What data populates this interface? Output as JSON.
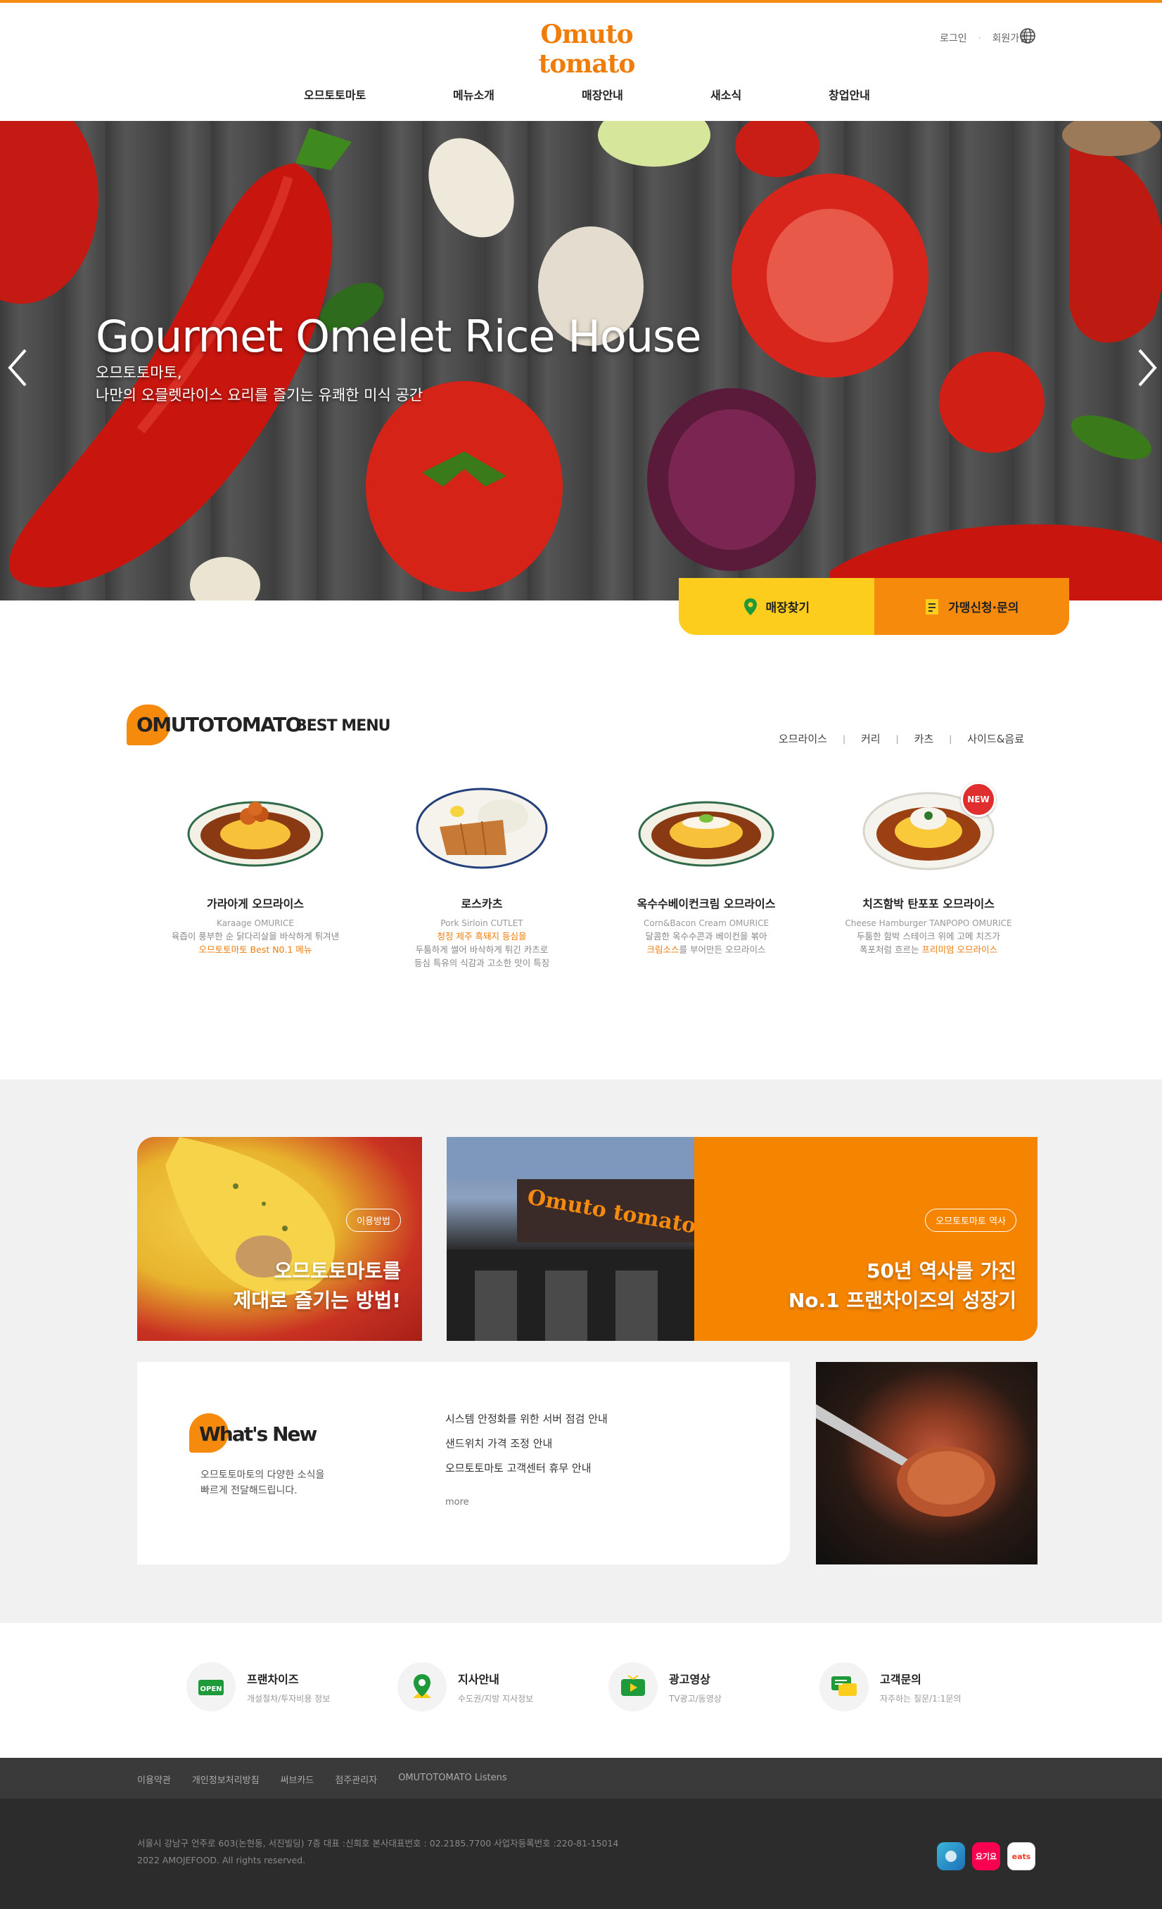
{
  "brand": {
    "logo_text": "Omuto tomato",
    "accent": "#f58a0d",
    "yellow": "#fccd1d"
  },
  "header": {
    "login": "로그인",
    "signup": "회원가입",
    "language_icon": "globe-icon"
  },
  "nav": [
    "오므토토마토",
    "메뉴소개",
    "매장안내",
    "새소식",
    "창업안내"
  ],
  "hero": {
    "title": "Gourmet Omelet Rice House",
    "sub1": "오므토토마토,",
    "sub2": "나만의 오믈렛라이스 요리를 즐기는 유쾌한 미식 공간"
  },
  "quick": {
    "store": "매장찾기",
    "franchise": "가맹신청·문의"
  },
  "best_menu": {
    "title_brand": "OMUTOTOMATO",
    "title_suffix": "BEST MENU",
    "tabs": [
      "오므라이스",
      "커리",
      "카츠",
      "사이드&음료"
    ],
    "items": [
      {
        "name": "가라아게 오므라이스",
        "en": "Karaage OMURICE",
        "desc1": "육즙이 풍부한 순 닭다리살을 바삭하게 튀겨낸",
        "desc2_hl": "오므토토마토 Best N0.1 메뉴",
        "desc2": ""
      },
      {
        "name": "로스카츠",
        "en": "Pork Sirloin CUTLET",
        "desc1_hl": "청정 제주 흑돼지 등심을",
        "desc2": "두툼하게 썰어 바삭하게 튀긴 카츠로",
        "desc3": "등심 특유의 식감과 고소한 맛이 특징"
      },
      {
        "name": "옥수수베이컨크림 오므라이스",
        "en": "Corn&Bacon Cream OMURICE",
        "desc1": "달콤한 옥수수콘과 베이컨을 볶아",
        "desc2_hl": "크림소스",
        "desc2": "를 부어만든 오므라이스"
      },
      {
        "name": "치즈함박 탄포포 오므라이스",
        "en": "Cheese Hamburger TANPOPO OMURICE",
        "desc1": "두툼한 함박 스테이크 위에 고메 치즈가",
        "desc2": "폭포처럼 흐르는 ",
        "desc2_hl": "프리미엄 오므라이스",
        "badge": "NEW"
      }
    ]
  },
  "promo": {
    "card1_pill": "이용방법",
    "card1_line1": "오므토토마토를",
    "card1_line2": "제대로 즐기는 방법!",
    "card2_pill": "오므토토마토 역사",
    "card2_line1": "50년 역사를 가진",
    "card2_line2": "No.1 프랜차이즈의 성장기"
  },
  "news": {
    "title": "What's New",
    "desc1": "오므토토마토의 다양한 소식을",
    "desc2": "빠르게 전달해드립니다.",
    "items": [
      "시스템 안정화를 위한 서버 점검 안내",
      "샌드위치 가격 조정 안내",
      "오므토토마토 고객센터 휴무 안내"
    ],
    "more": "more"
  },
  "services": [
    {
      "title": "프랜차이즈",
      "sub": "개설절차/투자비용 정보",
      "icon": "open-sign-icon",
      "icon_text": "OPEN"
    },
    {
      "title": "지사안내",
      "sub": "수도권/지방 지사정보",
      "icon": "map-pin-icon"
    },
    {
      "title": "광고영상",
      "sub": "TV광고/동영상",
      "icon": "tv-icon"
    },
    {
      "title": "고객문의",
      "sub": "자주하는 질문/1:1문의",
      "icon": "chat-bubble-icon"
    }
  ],
  "footer": {
    "links": [
      "이용약관",
      "개인정보처리방침",
      "써브카드",
      "점주관리자",
      "OMUTOTOMATO Listens"
    ],
    "address": "서울시 강남구 언주로 603(논현동, 서진빌딩) 7층 대표 :신희호 본사대표번호 : 02.2185.7700 사업자등록번호 :220-81-15014",
    "copyright": "2022 AMOJEFOOD. All rights reserved.",
    "apps": [
      "app-icon",
      "요기요",
      "eats"
    ]
  }
}
